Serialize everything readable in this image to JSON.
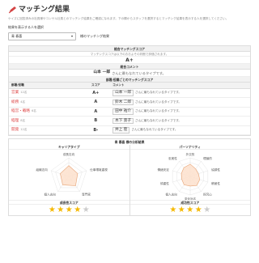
{
  "header": {
    "title": "マッチング結果",
    "title_icon": "pencil-icon",
    "description": "ケイズに回答済みの社員様やコンサル社員とのマッチング結果をご確認になれます。下の欄からスタッフを選択するとマッチング結果を表示する人を選択してください。"
  },
  "selector": {
    "label": "結果を表示する人を選択",
    "selected": "青 春喜",
    "suffix": "様のマッチング結果"
  },
  "overall": {
    "header": "総合マッチングスコア",
    "subtext": "マッチングスコアは以下のおおよその判断で評価されます。",
    "score": "A+"
  },
  "comment": {
    "header": "総合コメント",
    "name": "山本 一郎",
    "text": "さんに最もなれているタイプです。"
  },
  "departments": {
    "header": "部署/役職ごとのマッチングスコア",
    "columns": [
      "部署/役職",
      "スコア",
      "コメント"
    ],
    "rows": [
      {
        "dept": "営業",
        "count": "12名",
        "score": "A+",
        "person": "山本 一郎",
        "comment": "さんに最もなれているタイプです。"
      },
      {
        "dept": "総務",
        "count": "4名",
        "score": "A",
        "person": "鈴木 二郎",
        "comment": "さんに最もなれているタイプです。"
      },
      {
        "dept": "経営・戦略",
        "count": "6名",
        "score": "A",
        "person": "田中 祐介",
        "comment": "さんに最もなれているタイプです。"
      },
      {
        "dept": "経理",
        "count": "8名",
        "score": "B",
        "person": "木下 景子",
        "comment": "さんに最もなれているタイプです。"
      },
      {
        "dept": "開発",
        "count": "12名",
        "score": "B-",
        "person": "井上 陸",
        "comment": "さんに最もなれているタイプです。"
      }
    ]
  },
  "analysis": {
    "header": "青 春喜 様の分析結果",
    "career": {
      "title": "キャリアタイプ",
      "axes": [
        "成長志向",
        "仕事環境重視",
        "専門家",
        "個人志向",
        "組織志向"
      ],
      "values": [
        0.58,
        0.5,
        0.62,
        0.56,
        0.48
      ],
      "score_title": "成長性スコア",
      "stars": 4,
      "max_stars": 5
    },
    "personality": {
      "title": "パーソナリティ",
      "axes": [
        "外交的",
        "理論的",
        "協調性",
        "積極性",
        "探究心",
        "変化対応",
        "個人志向",
        "慎重性",
        "情緒安定",
        "忠実性"
      ],
      "values": [
        0.66,
        0.5,
        0.46,
        0.54,
        0.6,
        0.52,
        0.56,
        0.48,
        0.5,
        0.58
      ],
      "score_title": "成功性スコア",
      "stars": 4,
      "max_stars": 5
    }
  },
  "colors": {
    "accent": "#d44444",
    "radar_fill": "#fde0cc",
    "radar_stroke": "#e8a577",
    "star_on": "#f5b800",
    "star_off": "#cccccc"
  }
}
